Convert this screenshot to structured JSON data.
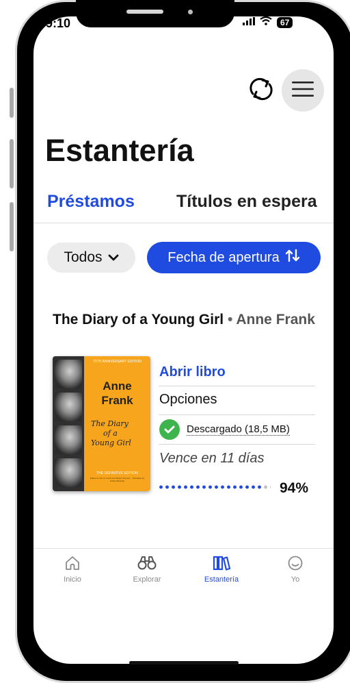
{
  "status_bar": {
    "time": "9:10",
    "battery": "67"
  },
  "header": {
    "title": "Estantería",
    "sync_icon": "sync-icon",
    "menu_icon": "menu-icon"
  },
  "tabs": [
    {
      "label": "Préstamos",
      "active": true
    },
    {
      "label": "Títulos en espera",
      "active": false
    }
  ],
  "filters": {
    "all_label": "Todos",
    "sort_label": "Fecha de apertura"
  },
  "loan": {
    "title": "The Diary of a Young Girl",
    "separator": "•",
    "author": "Anne Frank",
    "cover": {
      "edition_top": "70TH ANNIVERSARY EDITION",
      "author_first": "Anne",
      "author_last": "Frank",
      "script_title_1": "The Diary",
      "script_title_2": "of a",
      "script_title_3": "Young Girl",
      "edition_bottom": "THE DEFINITIVE EDITION",
      "credits": "Edited by Otto H. Frank and Mirjam Pressler · Translated by Susan Massotty"
    },
    "open_label": "Abrir libro",
    "options_label": "Opciones",
    "download_status": "Descargado (18,5 MB)",
    "due": "Vence en 11 días",
    "progress_percent": 94,
    "progress_label": "94%"
  },
  "nav": [
    {
      "label": "Inicio",
      "icon": "home-icon",
      "active": false
    },
    {
      "label": "Explorar",
      "icon": "binoculars-icon",
      "active": false
    },
    {
      "label": "Estantería",
      "icon": "bookshelf-icon",
      "active": true
    },
    {
      "label": "Yo",
      "icon": "smiley-icon",
      "active": false
    }
  ],
  "colors": {
    "accent": "#1f4be0",
    "success": "#3eb44d",
    "cover_orange": "#f7a51c"
  }
}
